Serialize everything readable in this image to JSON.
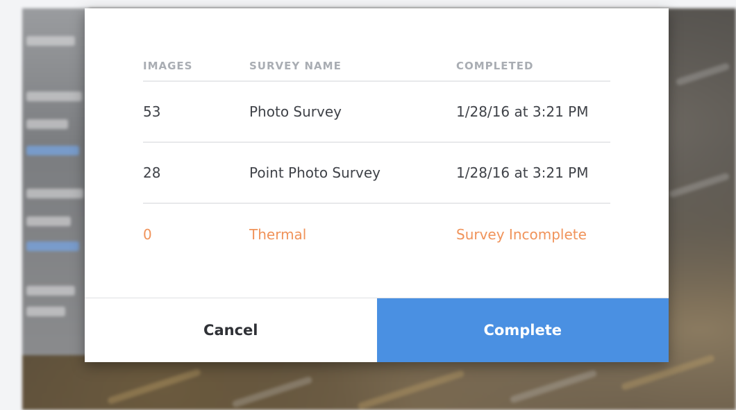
{
  "survey_table": {
    "headers": {
      "images": "IMAGES",
      "survey_name": "SURVEY NAME",
      "completed": "COMPLETED"
    },
    "rows": [
      {
        "images": "53",
        "survey_name": "Photo Survey",
        "completed": "1/28/16 at 3:21 PM",
        "status": "complete"
      },
      {
        "images": "28",
        "survey_name": "Point Photo Survey",
        "completed": "1/28/16 at 3:21 PM",
        "status": "complete"
      },
      {
        "images": "0",
        "survey_name": "Thermal",
        "completed": "Survey Incomplete",
        "status": "incomplete"
      }
    ]
  },
  "buttons": {
    "cancel_label": "Cancel",
    "complete_label": "Complete"
  },
  "colors": {
    "primary": "#4a90e2",
    "warning": "#f0935a",
    "header_text": "#a9adb3",
    "body_text": "#3f4248"
  }
}
